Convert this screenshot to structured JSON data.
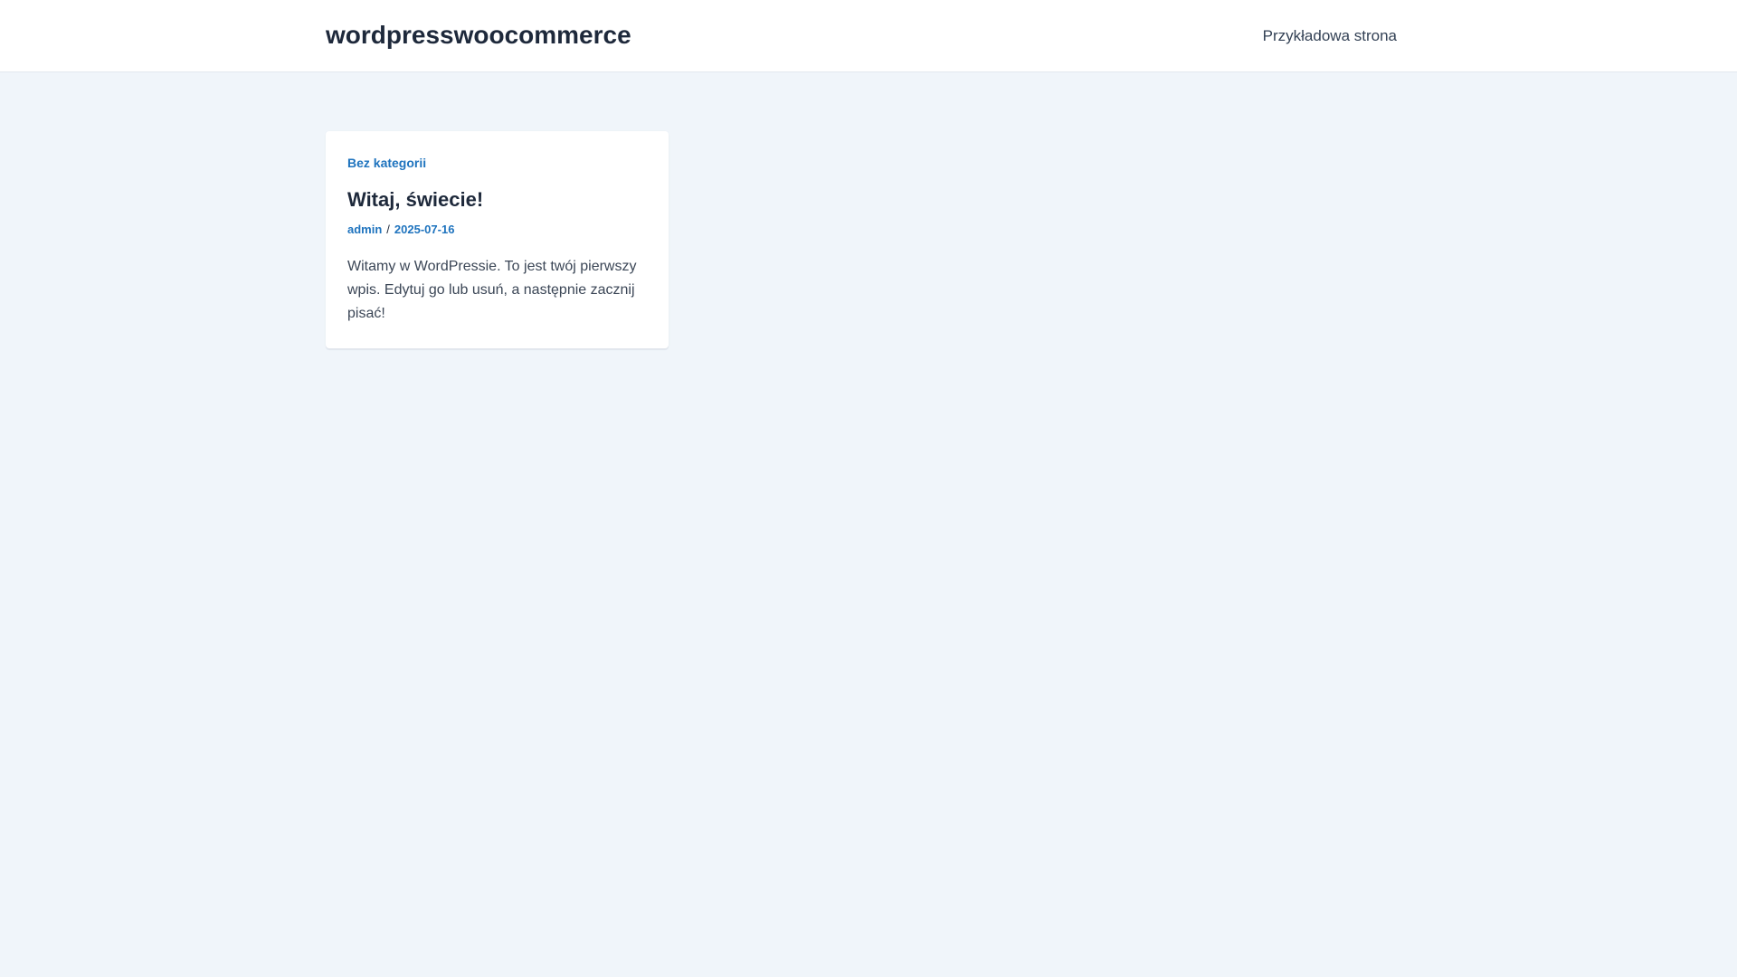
{
  "header": {
    "site_title": "wordpresswoocommerce",
    "nav": [
      {
        "label": "Przykładowa strona"
      }
    ]
  },
  "posts": [
    {
      "category": "Bez kategorii",
      "title": "Witaj, świecie!",
      "author": "admin",
      "separator": "/",
      "date": "2025-07-16",
      "excerpt": "Witamy w WordPressie. To jest twój pierwszy wpis. Edytuj go lub usuń, a następnie zacznij pisać!"
    }
  ],
  "colors": {
    "background": "#f0f5fa",
    "accent": "#1e73be",
    "text": "#1e293b"
  }
}
